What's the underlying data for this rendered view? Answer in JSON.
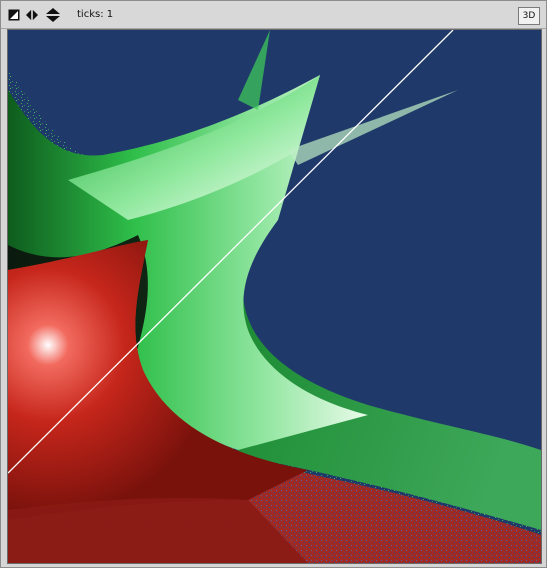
{
  "window": {
    "title": ""
  },
  "toolbar": {
    "zoom_icon": "zoom-fit-icon",
    "pan_horizontal_icon": "horizontal-arrows-icon",
    "pan_vertical_icon": "vertical-arrows-icon",
    "ticks_label": "ticks: 1",
    "three_d_label": "3D"
  },
  "view": {
    "colors": {
      "background": "#1f3a6a",
      "green_region": "#2fc24a",
      "green_highlight": "#ffffff",
      "red_region": "#b81e16",
      "dark_band": "#0b130c",
      "diagonal_line": "#ffffff"
    }
  }
}
